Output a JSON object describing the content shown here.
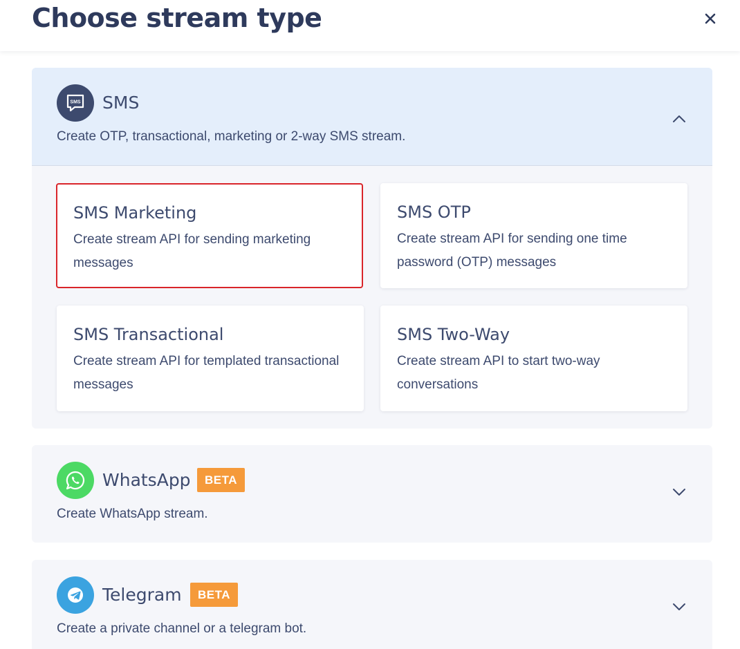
{
  "header": {
    "title": "Choose stream type",
    "close_icon": "close-icon"
  },
  "sections": {
    "sms": {
      "title": "SMS",
      "description": "Create OTP, transactional, marketing or 2-way SMS stream.",
      "icon": "sms-chat-icon",
      "icon_label": "SMS",
      "icon_color": "#3d4a6e",
      "expanded": true,
      "options": [
        {
          "title": "SMS Marketing",
          "description": "Create stream API for sending marketing messages",
          "selected": true
        },
        {
          "title": "SMS OTP",
          "description": "Create stream API for sending one time password (OTP) messages",
          "selected": false
        },
        {
          "title": "SMS Transactional",
          "description": "Create stream API for templated transactional messages",
          "selected": false
        },
        {
          "title": "SMS Two-Way",
          "description": "Create stream API to start two-way conversations",
          "selected": false
        }
      ]
    },
    "whatsapp": {
      "title": "WhatsApp",
      "badge": "BETA",
      "description": "Create WhatsApp stream.",
      "icon": "whatsapp-icon",
      "icon_color": "#4cd964",
      "expanded": false
    },
    "telegram": {
      "title": "Telegram",
      "badge": "BETA",
      "description": "Create a private channel or a telegram bot.",
      "icon": "telegram-icon",
      "icon_color": "#3ba3e0",
      "expanded": false
    }
  },
  "colors": {
    "accent_selected": "#d9252a",
    "badge": "#f59a3a",
    "text": "#3d4a6e",
    "sms_header_bg": "#e4eefb"
  }
}
